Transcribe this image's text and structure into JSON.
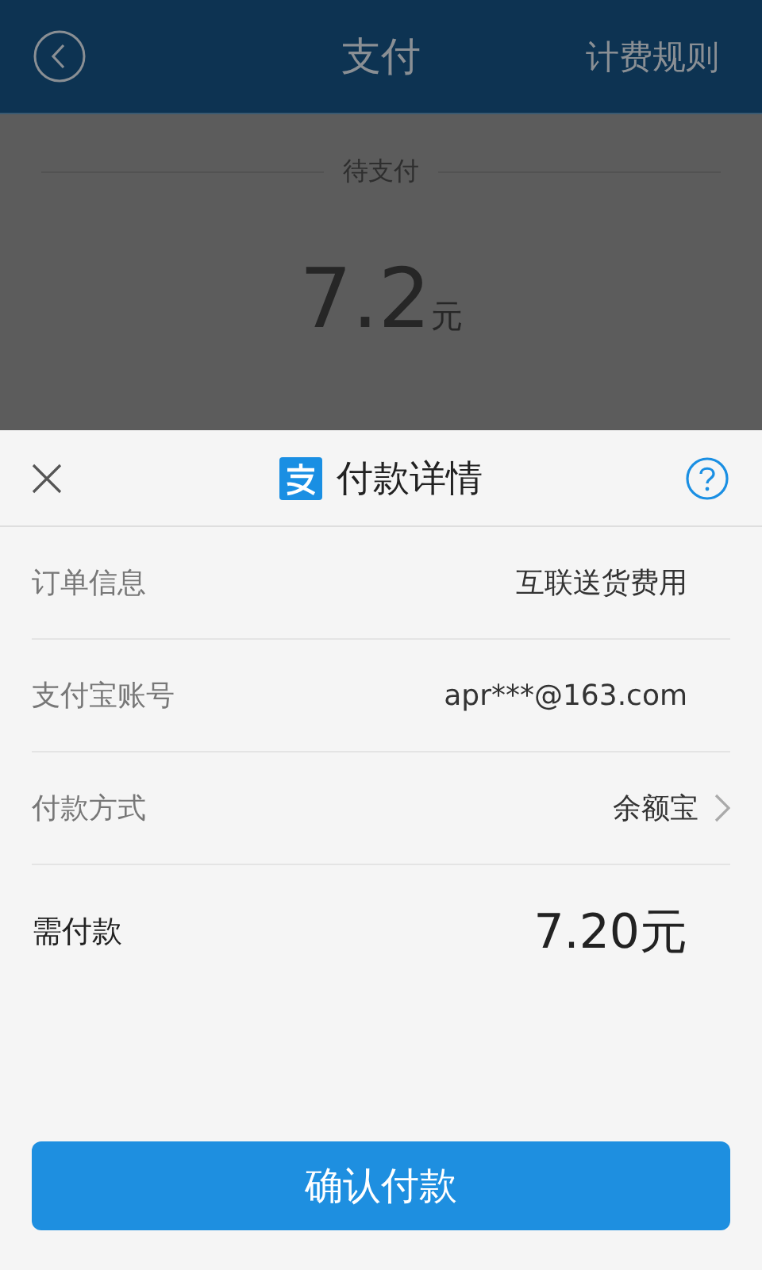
{
  "header": {
    "title": "支付",
    "action": "计费规则"
  },
  "summary": {
    "label": "待支付",
    "amount": "7.2",
    "unit": "元"
  },
  "sheet": {
    "title": "付款详情",
    "rows": [
      {
        "kind": "text",
        "label": "订单信息",
        "value": "互联送货费用"
      },
      {
        "kind": "text",
        "label": "支付宝账号",
        "value": "apr***@163.com"
      },
      {
        "kind": "link",
        "label": "付款方式",
        "value": "余额宝"
      },
      {
        "kind": "total",
        "label": "需付款",
        "value": "7.20元"
      }
    ],
    "confirm": "确认付款"
  }
}
